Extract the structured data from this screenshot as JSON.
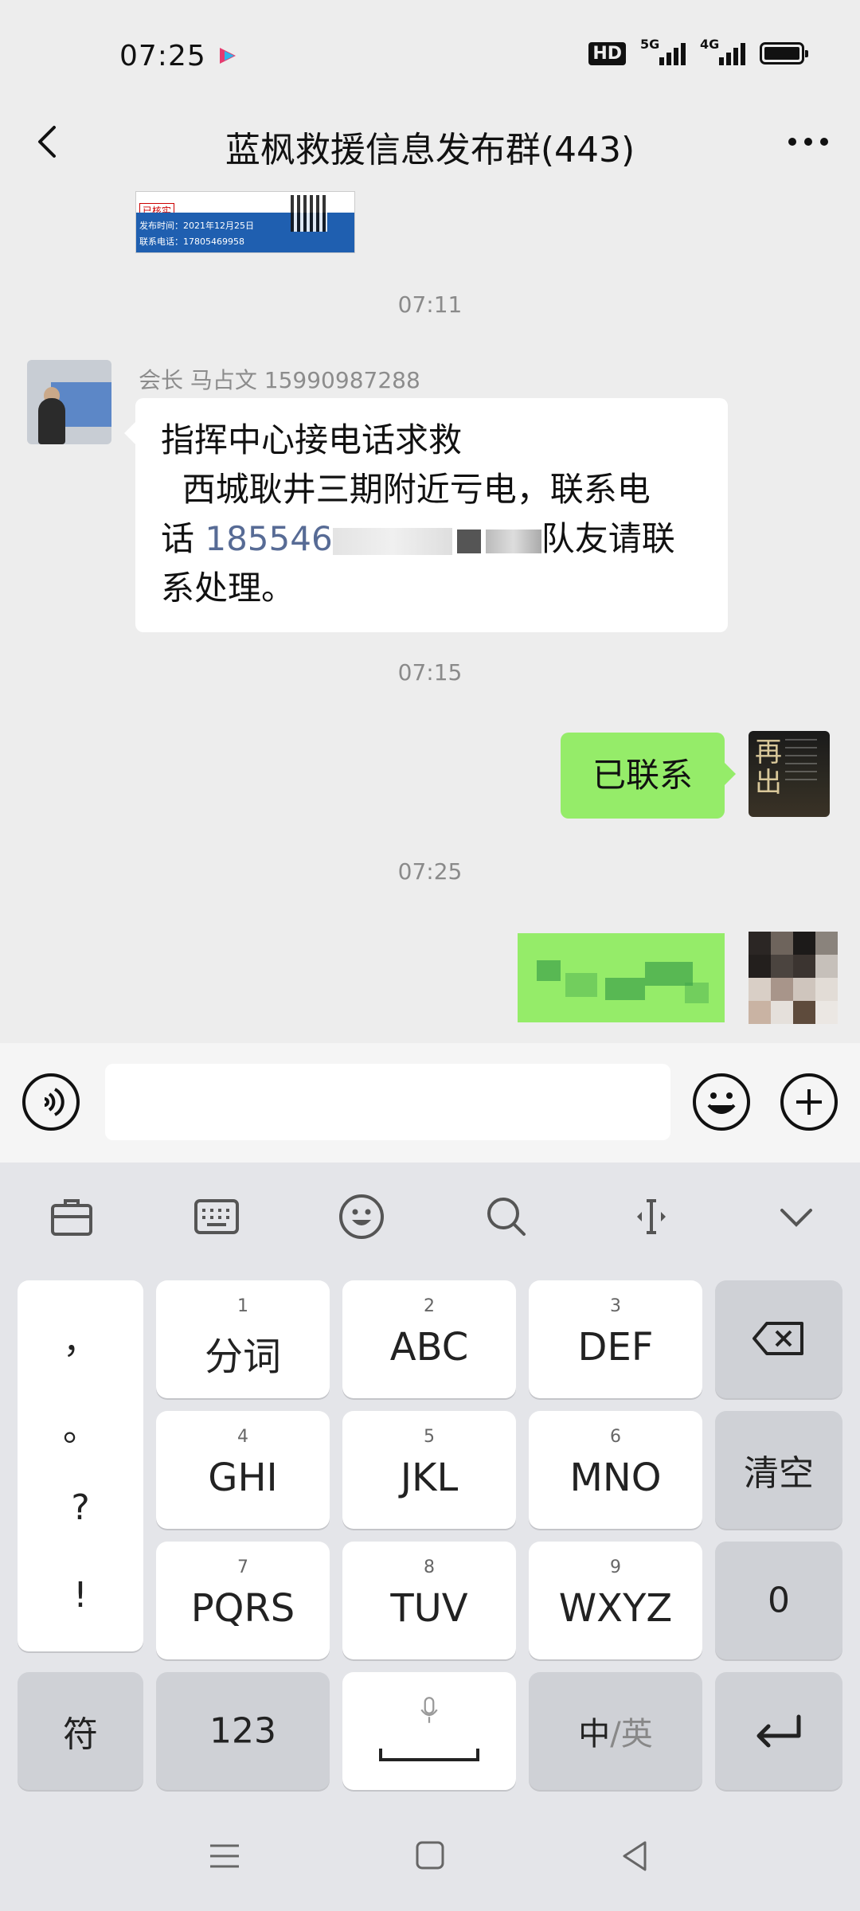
{
  "status_bar": {
    "time": "07:25",
    "hd_badge": "HD",
    "signal1_label": "5G",
    "signal2_label": "4G"
  },
  "header": {
    "title": "蓝枫救援信息发布群(443)"
  },
  "chat": {
    "top_image_card": {
      "tag": "已核实",
      "line1": "发布时间：2021年12月25日",
      "line2": "联系电话：17805469958"
    },
    "timestamps": [
      "07:11",
      "07:15",
      "07:25"
    ],
    "incoming": {
      "sender": "会长 马占文 15990987288",
      "line1": "指挥中心接电话求救",
      "line2": "  西城耿井三期附近亏电，联系电",
      "line3_prefix": "话 ",
      "line3_phone": "185546",
      "line3_suffix": "队友请联",
      "line4": "系处理。"
    },
    "outgoing_text": "已联系"
  },
  "input_bar": {
    "placeholder": ""
  },
  "keyboard": {
    "punctuation": [
      "，",
      "。",
      "?",
      "!"
    ],
    "rows": [
      [
        {
          "num": "1",
          "label": "分词"
        },
        {
          "num": "2",
          "label": "ABC"
        },
        {
          "num": "3",
          "label": "DEF"
        }
      ],
      [
        {
          "num": "4",
          "label": "GHI"
        },
        {
          "num": "5",
          "label": "JKL"
        },
        {
          "num": "6",
          "label": "MNO"
        }
      ],
      [
        {
          "num": "7",
          "label": "PQRS"
        },
        {
          "num": "8",
          "label": "TUV"
        },
        {
          "num": "9",
          "label": "WXYZ"
        }
      ]
    ],
    "clear_label": "清空",
    "zero_label": "0",
    "symbol_label": "符",
    "numbers_label": "123",
    "lang_label_left": "中",
    "lang_label_sep": "/",
    "lang_label_right": "英"
  },
  "colors": {
    "outgoing_bubble": "#95ec69",
    "link": "#576b95",
    "background": "#ededed"
  },
  "icons": [
    "back-icon",
    "more-icon",
    "voice-icon",
    "emoji-icon",
    "plus-icon",
    "briefcase-icon",
    "keyboard-icon",
    "smiley-icon",
    "search-icon",
    "cursor-icon",
    "collapse-icon",
    "backspace-icon",
    "mic-icon",
    "enter-icon",
    "menu-icon",
    "home-icon",
    "back-triangle-icon"
  ]
}
